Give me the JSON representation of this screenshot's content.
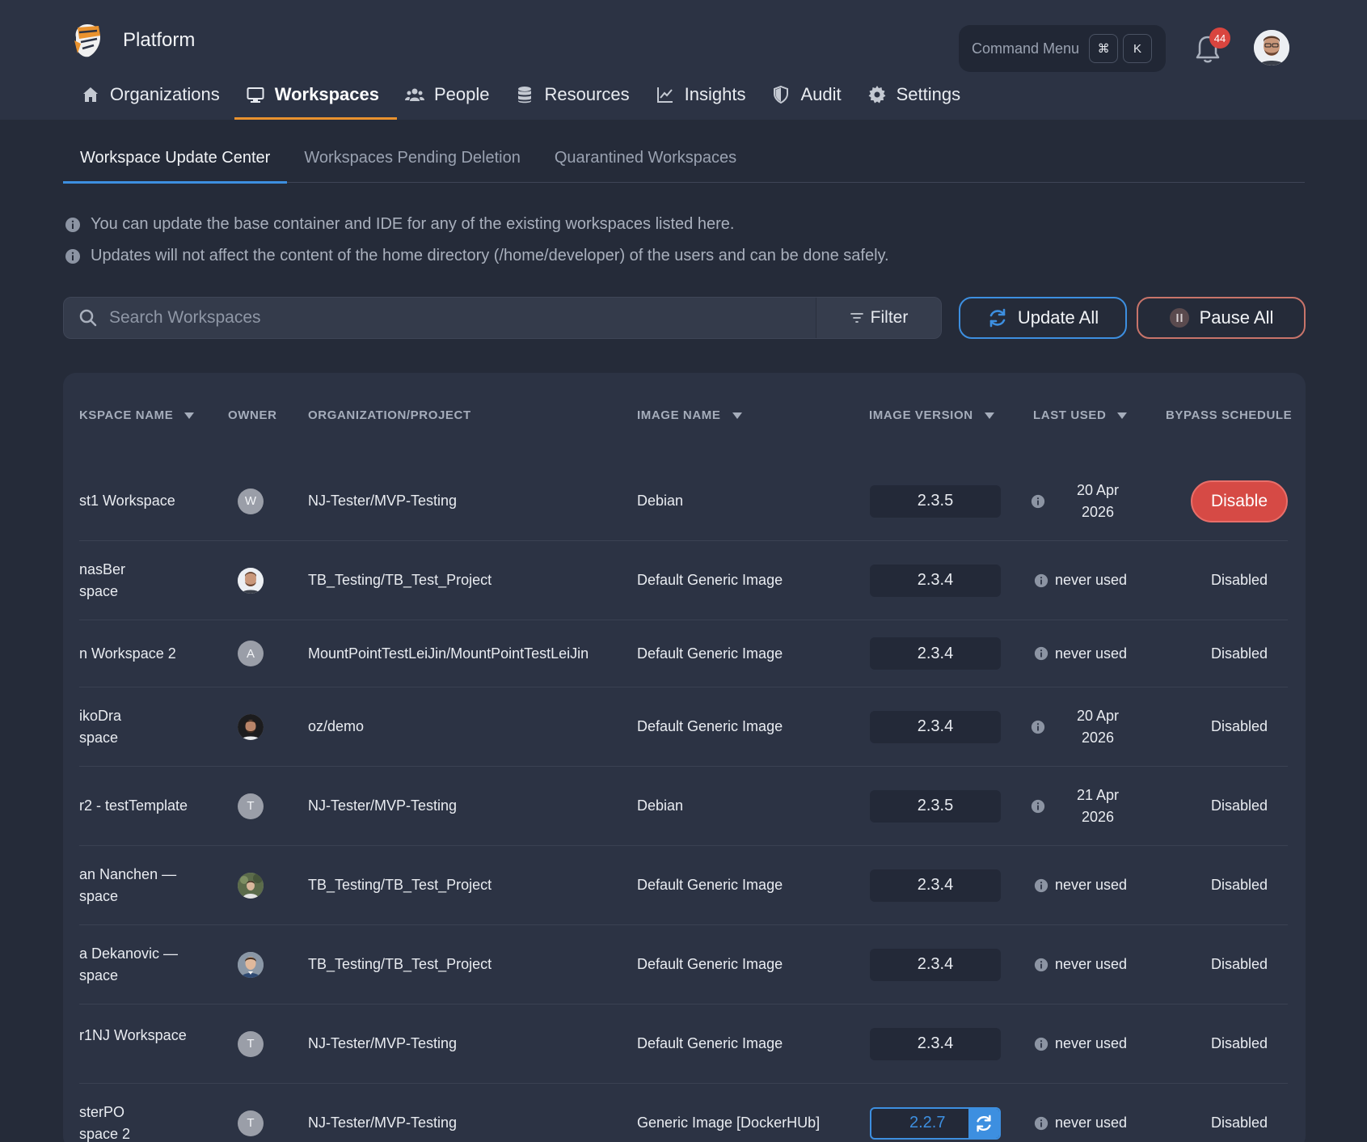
{
  "app": {
    "name": "Platform",
    "command_menu_label": "Command Menu",
    "command_key_1": "⌘",
    "command_key_2": "K",
    "notification_count": "44",
    "accent_color": "#e9922e",
    "primary_color": "#3d8fe0",
    "danger_color": "#d64a45"
  },
  "nav": {
    "items": [
      {
        "label": "Organizations",
        "icon": "home-icon"
      },
      {
        "label": "Workspaces",
        "icon": "monitor-icon",
        "active": true
      },
      {
        "label": "People",
        "icon": "people-icon"
      },
      {
        "label": "Resources",
        "icon": "database-icon"
      },
      {
        "label": "Insights",
        "icon": "chart-line-icon"
      },
      {
        "label": "Audit",
        "icon": "shield-icon"
      },
      {
        "label": "Settings",
        "icon": "gear-icon"
      }
    ]
  },
  "subtabs": [
    {
      "label": "Workspace Update Center",
      "active": true
    },
    {
      "label": "Workspaces Pending Deletion"
    },
    {
      "label": "Quarantined Workspaces"
    }
  ],
  "info": {
    "line1": "You can update the base container and IDE for any of the existing workspaces listed here.",
    "line2": "Updates will not affect the content of the home directory (/home/developer) of the users and can be done safely."
  },
  "toolbar": {
    "search_placeholder": "Search Workspaces",
    "filter_label": "Filter",
    "update_all_label": "Update All",
    "pause_all_label": "Pause All"
  },
  "table": {
    "headers": {
      "name": "KSPACE NAME",
      "owner": "OWNER",
      "org": "ORGANIZATION/PROJECT",
      "image": "IMAGE NAME",
      "version": "IMAGE VERSION",
      "last_used": "LAST USED",
      "bypass": "BYPASS SCHEDULE"
    },
    "rows": [
      {
        "name": "st1 Workspace",
        "owner": "W",
        "org": "NJ-Tester/MVP-Testing",
        "image": "Debian",
        "version": "2.3.5",
        "last_used": "20 Apr\n2026",
        "bypass": "Disable"
      },
      {
        "name": "nasBer\nspace",
        "owner": "",
        "org": "TB_Testing/TB_Test_Project",
        "image": "Default Generic Image",
        "version": "2.3.4",
        "last_used": "never used",
        "bypass": "Disabled"
      },
      {
        "name": "n Workspace 2",
        "owner": "A",
        "org": "MountPointTestLeiJin/MountPointTestLeiJin",
        "image": "Default Generic Image",
        "version": "2.3.4",
        "last_used": "never used",
        "bypass": "Disabled"
      },
      {
        "name": "ikoDra\nspace",
        "owner": "",
        "org": "oz/demo",
        "image": "Default Generic Image",
        "version": "2.3.4",
        "last_used": "20 Apr\n2026",
        "bypass": "Disabled"
      },
      {
        "name": "r2 - testTemplate",
        "owner": "T",
        "org": "NJ-Tester/MVP-Testing",
        "image": "Debian",
        "version": "2.3.5",
        "last_used": "21 Apr\n2026",
        "bypass": "Disabled"
      },
      {
        "name": "an Nanchen —\nspace",
        "owner": "",
        "org": "TB_Testing/TB_Test_Project",
        "image": "Default Generic Image",
        "version": "2.3.4",
        "last_used": "never used",
        "bypass": "Disabled"
      },
      {
        "name": "a Dekanovic —\nspace",
        "owner": "",
        "org": "TB_Testing/TB_Test_Project",
        "image": "Default Generic Image",
        "version": "2.3.4",
        "last_used": "never used",
        "bypass": "Disabled"
      },
      {
        "name": "r1NJ Workspace",
        "owner": "T",
        "org": "NJ-Tester/MVP-Testing",
        "image": "Default Generic Image",
        "version": "2.3.4",
        "last_used": "never used",
        "bypass": "Disabled"
      },
      {
        "name": "sterPO\nspace 2",
        "owner": "T",
        "org": "NJ-Tester/MVP-Testing",
        "image": "Generic Image [DockerHUb]",
        "version": "2.2.7",
        "last_used": "never used",
        "bypass": "Disabled"
      }
    ]
  }
}
